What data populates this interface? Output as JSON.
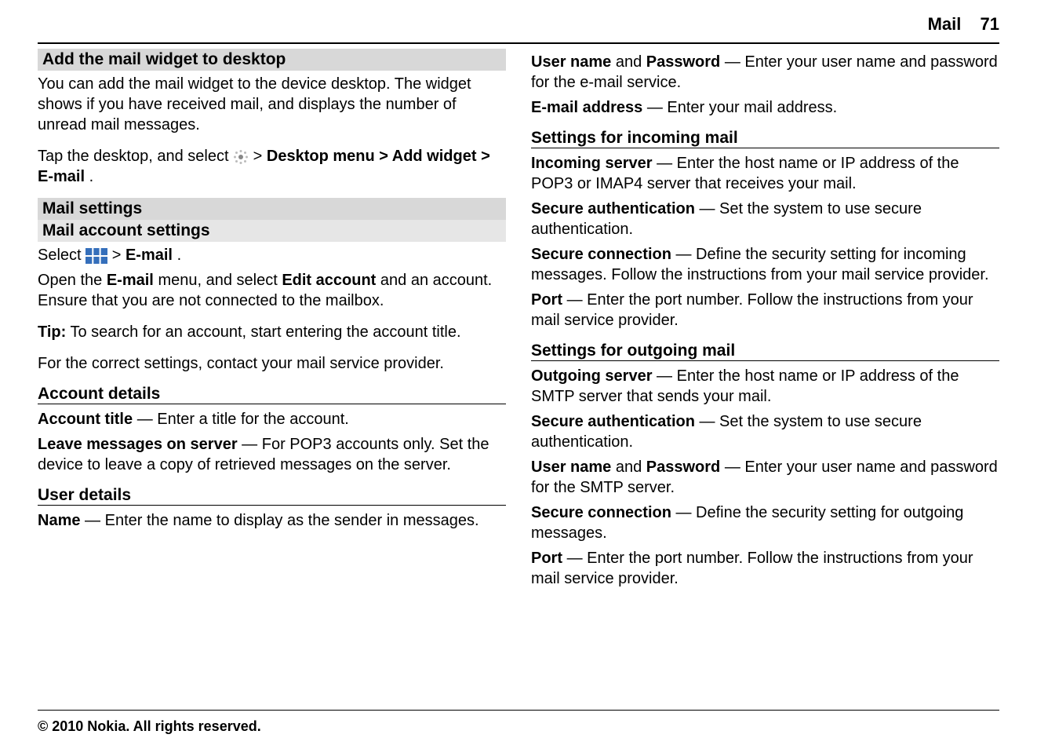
{
  "header": {
    "title": "Mail",
    "page": "71"
  },
  "left": {
    "h1": "Add the mail widget to desktop",
    "p1": "You can add the mail widget to the device desktop. The widget shows if you have received mail, and displays the number of unread mail messages.",
    "p2a": "Tap the desktop, and select ",
    "p2b": " > ",
    "p2_desktop_menu": "Desktop menu",
    "p2c": " > ",
    "p2_add_widget": "Add widget",
    "p2d": " > ",
    "p2_email": "E-mail",
    "p2e": ".",
    "h2": "Mail settings",
    "h2b": "Mail account settings",
    "p3a": "Select ",
    "p3b": " > ",
    "p3_email": "E-mail",
    "p3c": ".",
    "p4a": "Open the ",
    "p4_email": "E-mail",
    "p4b": " menu, and select ",
    "p4_edit": "Edit account",
    "p4c": " and an account. Ensure that you are not connected to the mailbox.",
    "p5_tip": "Tip:",
    "p5": " To search for an account, start entering the account title.",
    "p6": "For the correct settings, contact your mail service provider.",
    "h3": "Account details",
    "p7_label": "Account title",
    "p7": " — Enter a title for the account.",
    "p8_label": "Leave messages on server",
    "p8": " — For POP3 accounts only. Set the device to leave a copy of retrieved messages on the server.",
    "h4": "User details",
    "p9_label": "Name",
    "p9": " — Enter the name to display as the sender in messages."
  },
  "right": {
    "p1_user": "User name",
    "p1_and": " and ",
    "p1_pwd": "Password",
    "p1": " — Enter your user name and password for the e-mail service.",
    "p2_label": "E-mail address",
    "p2": " — Enter your mail address.",
    "h1": "Settings for incoming mail",
    "p3_label": "Incoming server",
    "p3": " — Enter the host name or IP address of the POP3 or IMAP4 server that receives your mail.",
    "p4_label": "Secure authentication",
    "p4": " — Set the system to use secure authentication.",
    "p5_label": "Secure connection",
    "p5": " — Define the security setting for incoming messages. Follow the instructions from your mail service provider.",
    "p6_label": "Port",
    "p6": " — Enter the port number. Follow the instructions from your mail service provider.",
    "h2": "Settings for outgoing mail",
    "p7_label": "Outgoing server",
    "p7": " — Enter the host name or IP address of the SMTP server that sends your mail.",
    "p8_label": "Secure authentication",
    "p8": " — Set the system to use secure authentication.",
    "p9_user": "User name",
    "p9_and": " and ",
    "p9_pwd": "Password",
    "p9": " — Enter your user name and password for the SMTP server.",
    "p10_label": "Secure connection",
    "p10": " — Define the security setting for outgoing messages.",
    "p11_label": "Port",
    "p11": " — Enter the port number. Follow the instructions from your mail service provider."
  },
  "footer": "© 2010 Nokia. All rights reserved."
}
